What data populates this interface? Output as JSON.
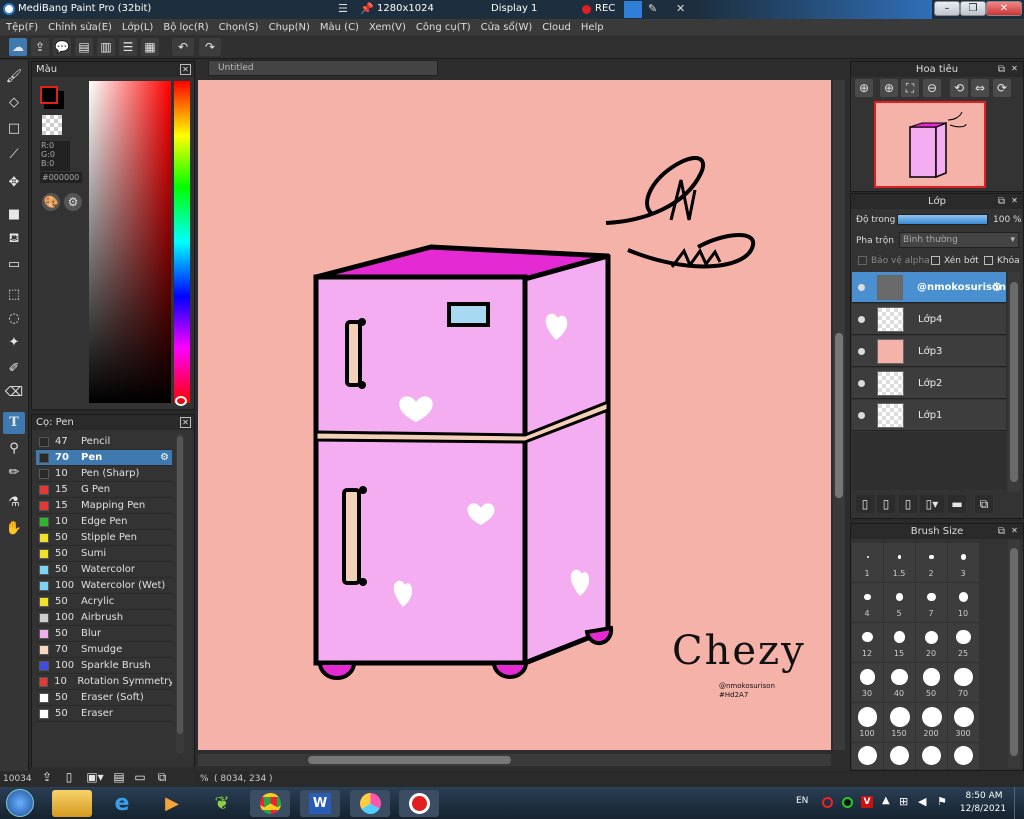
{
  "window": {
    "title": "MediBang Paint Pro (32bit)",
    "resolution": "1280x1024",
    "display": "Display 1",
    "rec_label": "REC",
    "minimize": "–",
    "restore": "❒",
    "close": "✕"
  },
  "menu": [
    "Tệp(F)",
    "Chỉnh sửa(E)",
    "Lớp(L)",
    "Bộ lọc(R)",
    "Chọn(S)",
    "Chụp(N)",
    "Màu (C)",
    "Xem(V)",
    "Công cụ(T)",
    "Cửa sổ(W)",
    "Cloud",
    "Help"
  ],
  "color_panel": {
    "title": "Màu",
    "r": "R:0",
    "g": "G:0",
    "b": "B:0",
    "hex": "#000000",
    "current_color": "#000000"
  },
  "brush_panel": {
    "title": "Cọ: Pen",
    "brushes": [
      {
        "size": "47",
        "name": "Pencil",
        "color": "#2a2a2a"
      },
      {
        "size": "70",
        "name": "Pen",
        "color": "#2a2a2a",
        "selected": true
      },
      {
        "size": "10",
        "name": "Pen (Sharp)",
        "color": "#2a2a2a"
      },
      {
        "size": "15",
        "name": "G Pen",
        "color": "#e53935"
      },
      {
        "size": "15",
        "name": "Mapping Pen",
        "color": "#e53935"
      },
      {
        "size": "10",
        "name": "Edge Pen",
        "color": "#2fb52f"
      },
      {
        "size": "50",
        "name": "Stipple Pen",
        "color": "#f2e12a"
      },
      {
        "size": "50",
        "name": "Sumi",
        "color": "#f2e12a"
      },
      {
        "size": "50",
        "name": "Watercolor",
        "color": "#7fd3f5"
      },
      {
        "size": "100",
        "name": "Watercolor (Wet)",
        "color": "#7fd3f5"
      },
      {
        "size": "50",
        "name": "Acrylic",
        "color": "#f2e12a"
      },
      {
        "size": "100",
        "name": "Airbrush",
        "color": "#cfcfcf"
      },
      {
        "size": "50",
        "name": "Blur",
        "color": "#f0b0ec"
      },
      {
        "size": "70",
        "name": "Smudge",
        "color": "#f6d9c0"
      },
      {
        "size": "100",
        "name": "Sparkle Brush",
        "color": "#3f4ee0"
      },
      {
        "size": "10",
        "name": "Rotation Symmetry P",
        "color": "#e53935"
      },
      {
        "size": "50",
        "name": "Eraser (Soft)",
        "color": "#ffffff"
      },
      {
        "size": "50",
        "name": "Eraser",
        "color": "#ffffff"
      }
    ]
  },
  "canvas": {
    "tab_title": "Untitled",
    "status_zoom": "10034",
    "status_percent": "%",
    "status_coords": "( 8034, 234 )",
    "signature": "Chezy",
    "watermark_line1": "@nmokosurison",
    "watermark_line2": "#Hd2A7"
  },
  "navigator": {
    "title": "Hoa tiêu"
  },
  "layers_panel": {
    "title": "Lớp",
    "opacity_label": "Độ trong",
    "opacity_value": "100 %",
    "blend_label": "Pha trộn",
    "blend_value": "Bình thường",
    "protect_alpha": "Bảo vệ alpha",
    "clipping": "Xén bớt",
    "lock": "Khóa",
    "layers": [
      {
        "name": "@nmokosurison",
        "selected": true
      },
      {
        "name": "Lớp4"
      },
      {
        "name": "Lớp3"
      },
      {
        "name": "Lớp2"
      },
      {
        "name": "Lớp1"
      }
    ]
  },
  "brush_size_panel": {
    "title": "Brush Size",
    "sizes": [
      "1",
      "1.5",
      "2",
      "3",
      "4",
      "5",
      "7",
      "10",
      "12",
      "15",
      "20",
      "25",
      "30",
      "40",
      "50",
      "70",
      "100",
      "150",
      "200",
      "300"
    ]
  },
  "taskbar": {
    "lang": "EN",
    "time": "8:50 AM",
    "date": "12/8/2021"
  }
}
